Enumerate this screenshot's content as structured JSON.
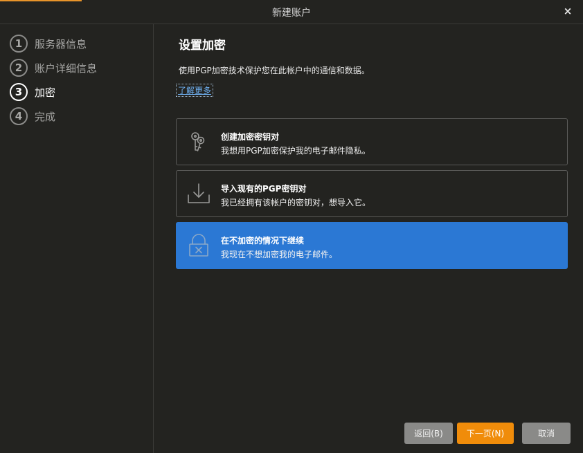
{
  "window": {
    "title": "新建账户",
    "close_icon": "×"
  },
  "sidebar": {
    "steps": [
      {
        "num": "1",
        "label": "服务器信息"
      },
      {
        "num": "2",
        "label": "账户详细信息"
      },
      {
        "num": "3",
        "label": "加密",
        "active": true
      },
      {
        "num": "4",
        "label": "完成"
      }
    ]
  },
  "main": {
    "title": "设置加密",
    "description": "使用PGP加密技术保护您在此帐户中的通信和数据。",
    "learn_more": "了解更多",
    "options": [
      {
        "icon": "keys-icon",
        "title": "创建加密密钥对",
        "desc": "我想用PGP加密保护我的电子邮件隐私。"
      },
      {
        "icon": "download-icon",
        "title": "导入现有的PGP密钥对",
        "desc": "我已经拥有该帐户的密钥对，想导入它。"
      },
      {
        "icon": "lock-x-icon",
        "title": "在不加密的情况下继续",
        "desc": "我现在不想加密我的电子邮件。",
        "selected": true
      }
    ]
  },
  "buttons": {
    "back": "返回(B)",
    "next": "下一页(N)",
    "cancel": "取消"
  },
  "colors": {
    "accent": "#f08c0a",
    "selection": "#2b78d4",
    "background": "#232320"
  }
}
